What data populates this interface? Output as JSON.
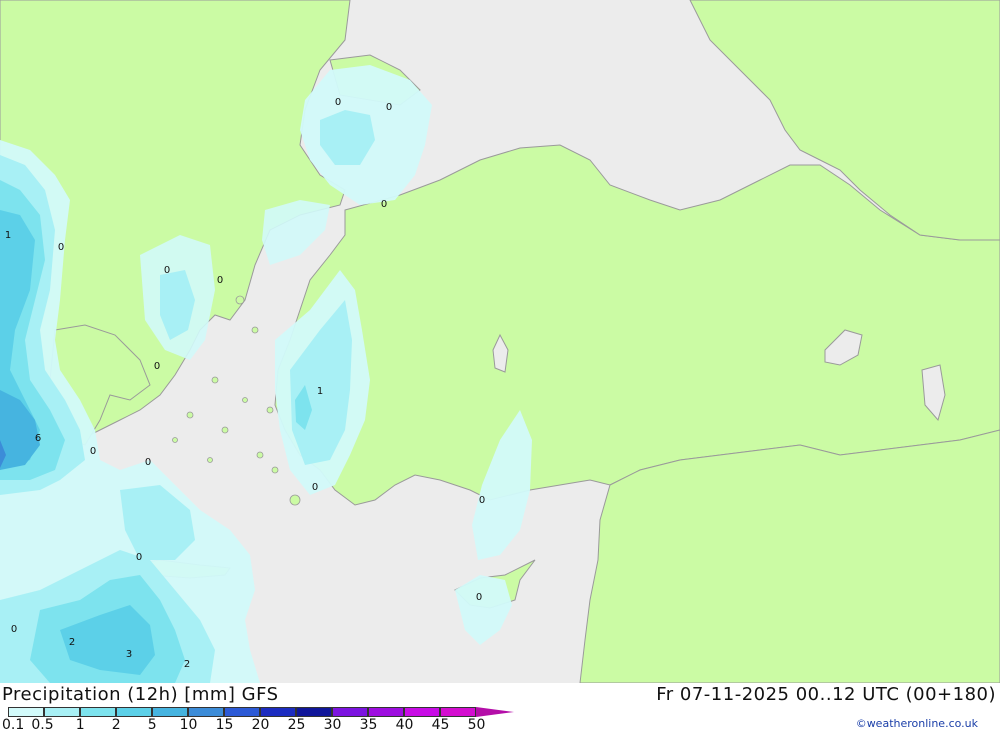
{
  "title": {
    "main": "Precipitation (12h) [mm] GFS",
    "datetime": "Fr 07-11-2025 00..12 UTC (00+180)",
    "credit": "©weatheronline.co.uk"
  },
  "scale": {
    "labels": [
      "0.1",
      "0.5",
      "1",
      "2",
      "5",
      "10",
      "15",
      "20",
      "25",
      "30",
      "35",
      "40",
      "45",
      "50"
    ],
    "colors": [
      "#d2fafa",
      "#a8f0f5",
      "#7de3ee",
      "#5cd0e8",
      "#46b4e0",
      "#3c8cd8",
      "#2c5ad6",
      "#1c2cc0",
      "#10169a",
      "#7c14e0",
      "#9e0ee0",
      "#c80ce6",
      "#d40ed0",
      "#b40ea8"
    ]
  },
  "map": {
    "colors": {
      "sea": "#ececec",
      "land": "#cbfba4",
      "border": "#9a9a9a",
      "precip_01": "#d2fafa",
      "precip_05": "#a8f0f5",
      "precip_1": "#7de3ee",
      "precip_2": "#5cd0e8",
      "precip_5": "#46b4e0",
      "precip_10": "#3c8cd8"
    },
    "contour_labels": [
      "0",
      "0",
      "0",
      "1",
      "0",
      "0",
      "0",
      "0",
      "1",
      "6",
      "0",
      "0",
      "0",
      "0",
      "0",
      "0",
      "0",
      "2",
      "3",
      "2"
    ]
  }
}
